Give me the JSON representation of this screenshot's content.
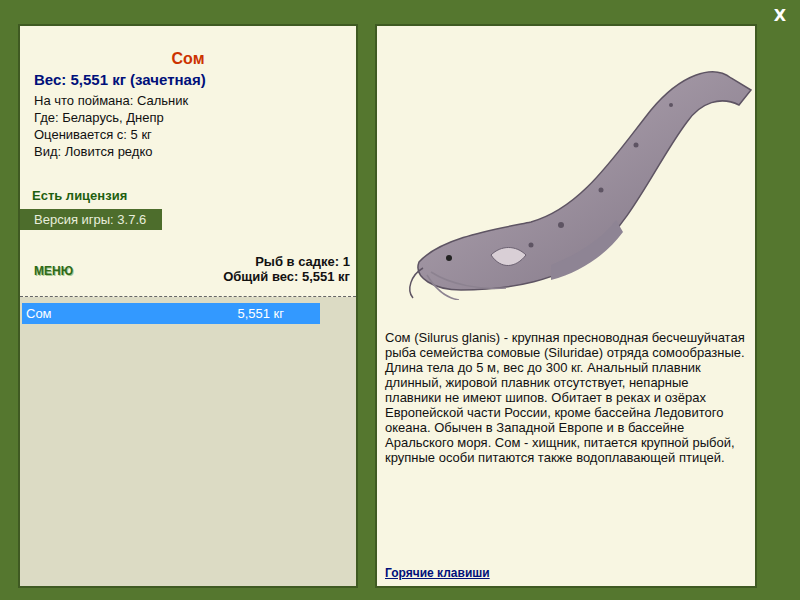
{
  "window": {
    "close": "X"
  },
  "fish": {
    "name": "Сом",
    "weight": "Вес: 5,551 кг (зачетная)",
    "details": [
      "На что поймана: Сальник",
      "Где: Беларусь, Днепр",
      "Оценивается с: 5 кг",
      "Вид: Ловится редко"
    ],
    "license": "Есть лицензия",
    "version_label": "Версия игры:",
    "version": "3.7.6"
  },
  "menu": "МЕНЮ",
  "keepnet": {
    "count": "Рыб в садке: 1",
    "total": "Общий вес: 5,551 кг",
    "items": [
      {
        "name": "Сом",
        "weight": "5,551 кг",
        "selected": true
      }
    ]
  },
  "description": "Сом (Silurus glanis) - крупная пресноводная бесчешуйчатая рыба семейства сомовые (Siluridae) отряда сомообразные. Длина тела до 5 м, вес до 300 кг. Анальный плавник длинный, жировой плавник отсутствует, непарные плавники не имеют шипов. Обитает в реках и озёрах Европейской части России, кроме бассейна Ледовитого океана. Обычен в Западной Европе и в бассейне Аральского моря. Сом - хищник, питается крупной рыбой, крупные особи питаются также водоплавающей птицей.",
  "hotkeys_link": "Горячие клавиши"
}
